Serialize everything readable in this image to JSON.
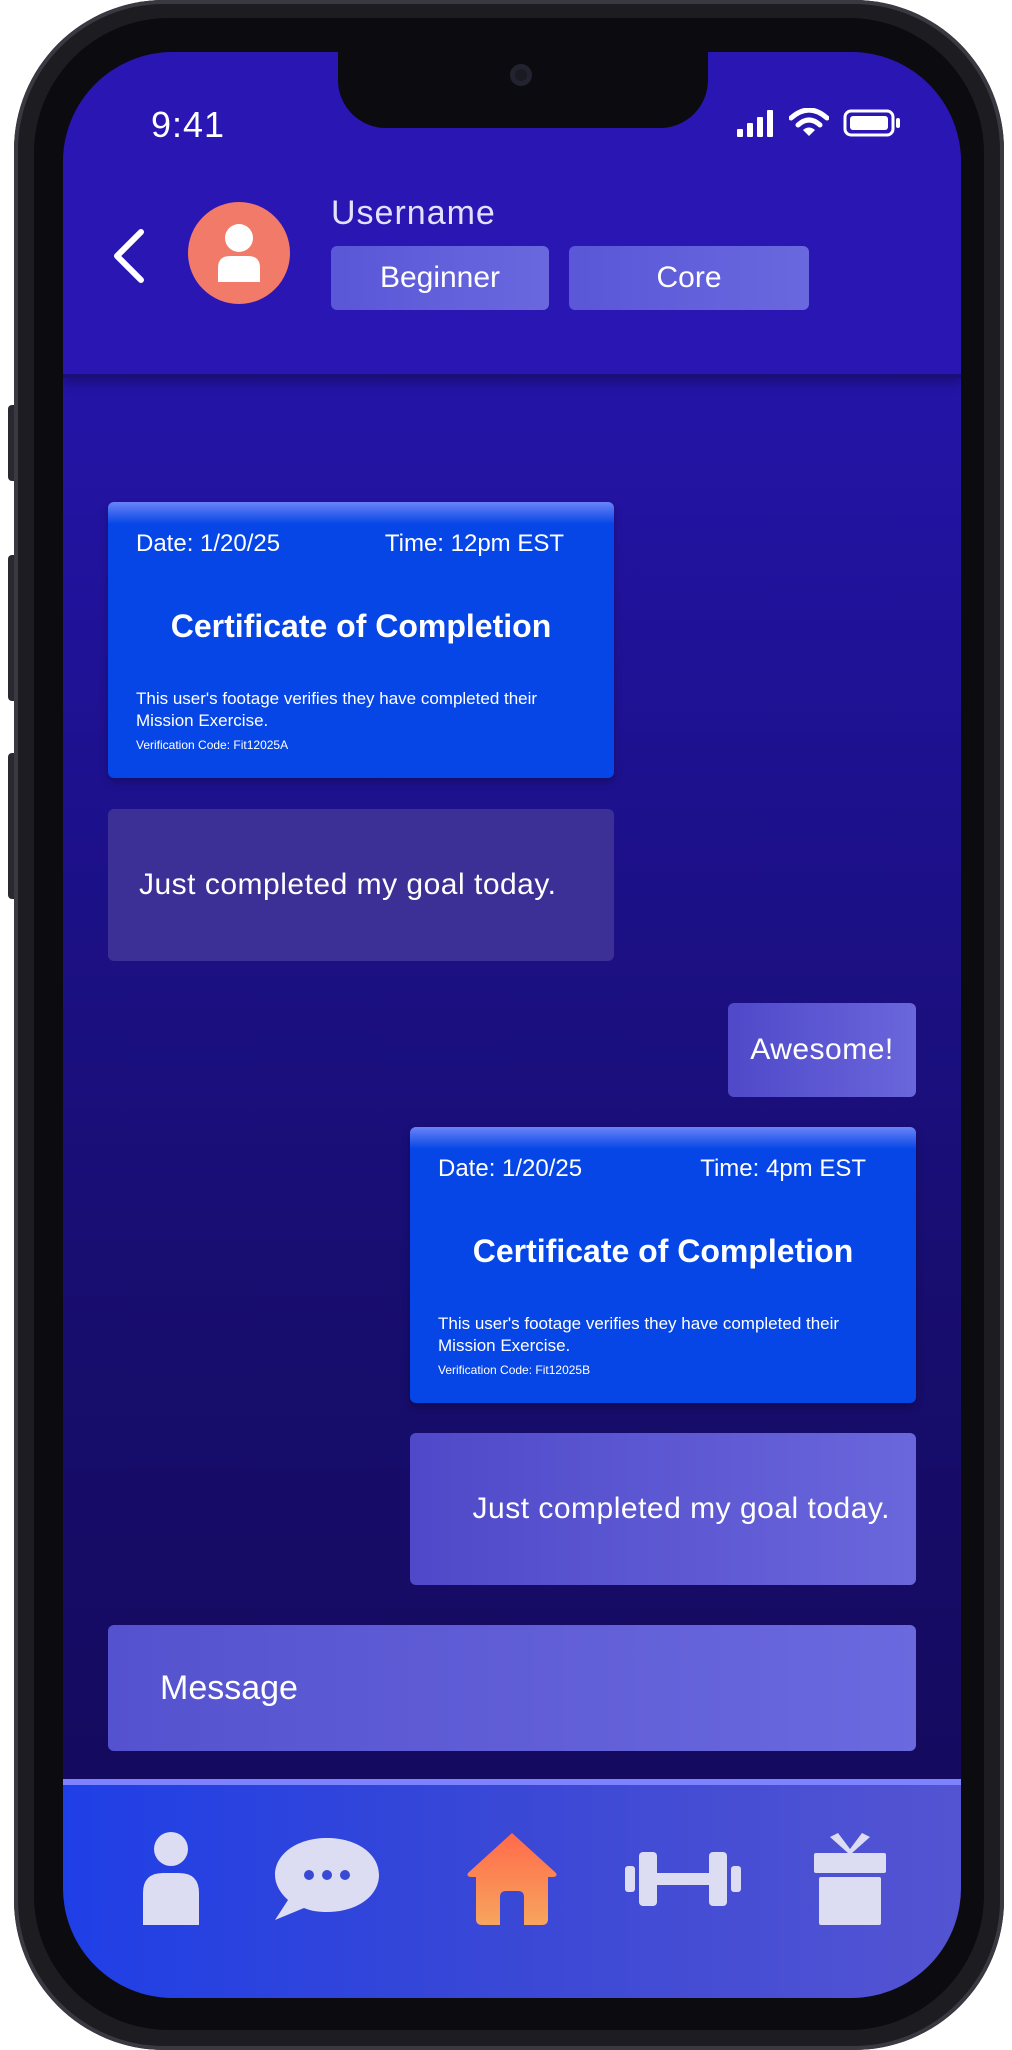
{
  "status_bar": {
    "time": "9:41"
  },
  "header": {
    "username": "Username",
    "tags": [
      "Beginner",
      "Core"
    ]
  },
  "messages": [
    {
      "type": "certificate",
      "side": "received",
      "date": "Date: 1/20/25",
      "time": "Time: 12pm EST",
      "title": "Certificate of Completion",
      "body": "This user's footage verifies they have completed their Mission Exercise.",
      "code": "Verification Code: Fit12025A"
    },
    {
      "type": "text",
      "side": "received",
      "text": "Just completed my goal today."
    },
    {
      "type": "text",
      "side": "sent",
      "text": "Awesome!"
    },
    {
      "type": "certificate",
      "side": "sent",
      "date": "Date: 1/20/25",
      "time": "Time: 4pm EST",
      "title": "Certificate of Completion",
      "body": "This user's footage verifies they have completed their Mission Exercise.",
      "code": "Verification Code: Fit12025B"
    },
    {
      "type": "text",
      "side": "sent",
      "text": "Just completed my goal today."
    }
  ],
  "composer": {
    "placeholder": "Message"
  },
  "nav": [
    {
      "icon": "profile-icon"
    },
    {
      "icon": "chat-icon"
    },
    {
      "icon": "home-icon",
      "active": true
    },
    {
      "icon": "dumbbell-icon"
    },
    {
      "icon": "gift-icon"
    }
  ],
  "colors": {
    "background": "#2414a6",
    "certificate": "#0646e6",
    "avatar": "#f27a68",
    "home_active": "#f58a4e"
  }
}
